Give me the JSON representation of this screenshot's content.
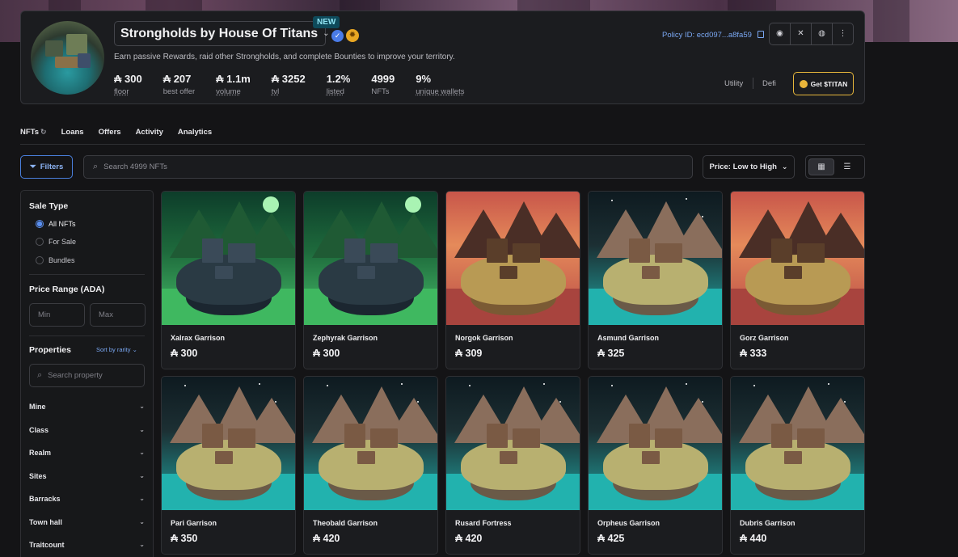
{
  "collection": {
    "title": "Strongholds by House Of Titans",
    "new_badge": "NEW",
    "tagline": "Earn passive Rewards, raid other Strongholds, and complete Bounties to improve your territory.",
    "policy": "Policy ID: ecd097...a8fa59",
    "stats": [
      {
        "value": "₳ 300",
        "label": "floor"
      },
      {
        "value": "₳ 207",
        "label": "best offer"
      },
      {
        "value": "₳ 1.1m",
        "label": "volume"
      },
      {
        "value": "₳ 3252",
        "label": "tvl"
      },
      {
        "value": "1.2%",
        "label": "listed"
      },
      {
        "value": "4999",
        "label": "NFTs"
      },
      {
        "value": "9%",
        "label": "unique wallets"
      }
    ],
    "socials": [
      "discord-icon",
      "x-icon",
      "globe-icon",
      "more-icon"
    ],
    "categories": [
      "Utility",
      "Defi"
    ],
    "get_button": "Get $TITAN"
  },
  "tabs": [
    "NFTs",
    "Loans",
    "Offers",
    "Activity",
    "Analytics"
  ],
  "controls": {
    "filters": "Filters",
    "search_placeholder": "Search 4999 NFTs",
    "sort": "Price: Low to High"
  },
  "sidebar": {
    "sale_type_title": "Sale Type",
    "sale_options": [
      "All NFTs",
      "For Sale",
      "Bundles"
    ],
    "price_range_title": "Price Range (ADA)",
    "min_placeholder": "Min",
    "max_placeholder": "Max",
    "properties_title": "Properties",
    "sort_by_rarity": "Sort by rarity",
    "property_search_placeholder": "Search property",
    "properties": [
      "Mine",
      "Class",
      "Realm",
      "Sites",
      "Barracks",
      "Town hall",
      "Traitcount"
    ]
  },
  "nfts": [
    {
      "name": "Xalrax Garrison",
      "price": "₳ 300",
      "theme": "green"
    },
    {
      "name": "Zephyrak Garrison",
      "price": "₳ 300",
      "theme": "green"
    },
    {
      "name": "Norgok Garrison",
      "price": "₳ 309",
      "theme": "red"
    },
    {
      "name": "Asmund Garrison",
      "price": "₳ 325",
      "theme": "night"
    },
    {
      "name": "Gorz Garrison",
      "price": "₳ 333",
      "theme": "red"
    },
    {
      "name": "Pari Garrison",
      "price": "₳ 350",
      "theme": "night"
    },
    {
      "name": "Theobald Garrison",
      "price": "₳ 420",
      "theme": "night"
    },
    {
      "name": "Rusard Fortress",
      "price": "₳ 420",
      "theme": "night"
    },
    {
      "name": "Orpheus Garrison",
      "price": "₳ 425",
      "theme": "night"
    },
    {
      "name": "Dubris Garrison",
      "price": "₳ 440",
      "theme": "night"
    }
  ],
  "colors": {
    "accent_blue": "#5a8ff0",
    "gold": "#e6b63b",
    "background": "#141416"
  }
}
